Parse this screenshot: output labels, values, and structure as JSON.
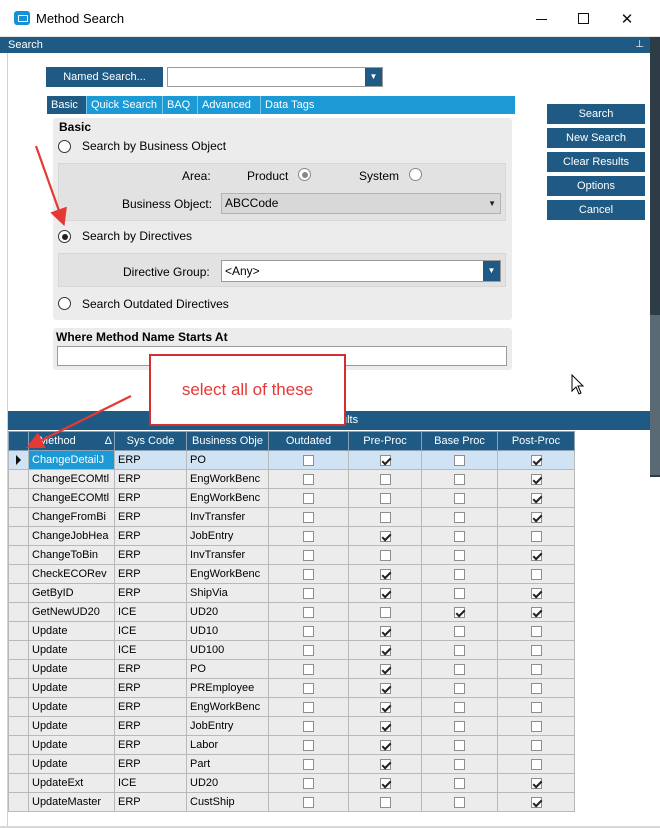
{
  "window": {
    "title": "Method Search",
    "icon": "method-search-app-icon"
  },
  "search_header": {
    "label": "Search"
  },
  "named_search": {
    "button_label": "Named Search...",
    "value": ""
  },
  "tabs": [
    {
      "label": "Basic",
      "active": true
    },
    {
      "label": "Quick Search",
      "active": false
    },
    {
      "label": "BAQ",
      "active": false
    },
    {
      "label": "Advanced",
      "active": false
    },
    {
      "label": "Data Tags",
      "active": false
    }
  ],
  "basic": {
    "title": "Basic",
    "by_business_object": {
      "label": "Search by Business Object",
      "selected": false
    },
    "area_label": "Area:",
    "area_product": {
      "label": "Product",
      "selected": true
    },
    "area_system": {
      "label": "System",
      "selected": false
    },
    "business_object_label": "Business Object:",
    "business_object_value": "ABCCode",
    "by_directives": {
      "label": "Search by Directives",
      "selected": true
    },
    "directive_group_label": "Directive Group:",
    "directive_group_value": "<Any>",
    "outdated": {
      "label": "Search Outdated Directives",
      "selected": false
    }
  },
  "where": {
    "title": "Where Method Name Starts At",
    "value": ""
  },
  "actions": [
    {
      "label": "Search"
    },
    {
      "label": "New Search"
    },
    {
      "label": "Clear Results"
    },
    {
      "label": "Options"
    },
    {
      "label": "Cancel"
    }
  ],
  "annotation": {
    "callout_text": "select all of these",
    "color": "#e53935"
  },
  "results": {
    "header_label": "ults",
    "columns": [
      "Method",
      "Sys Code",
      "Business Obje",
      "Outdated",
      "Pre-Proc",
      "Base Proc",
      "Post-Proc"
    ],
    "sort_indicator": "Δ",
    "rows": [
      {
        "method": "ChangeDetailJ",
        "sys": "ERP",
        "bo": "PO",
        "outdated": false,
        "pre": true,
        "base": false,
        "post": true,
        "selected": true
      },
      {
        "method": "ChangeECOMtl",
        "sys": "ERP",
        "bo": "EngWorkBenc",
        "outdated": false,
        "pre": false,
        "base": false,
        "post": true
      },
      {
        "method": "ChangeECOMtl",
        "sys": "ERP",
        "bo": "EngWorkBenc",
        "outdated": false,
        "pre": false,
        "base": false,
        "post": true
      },
      {
        "method": "ChangeFromBi",
        "sys": "ERP",
        "bo": "InvTransfer",
        "outdated": false,
        "pre": false,
        "base": false,
        "post": true
      },
      {
        "method": "ChangeJobHea",
        "sys": "ERP",
        "bo": "JobEntry",
        "outdated": false,
        "pre": true,
        "base": false,
        "post": false
      },
      {
        "method": "ChangeToBin",
        "sys": "ERP",
        "bo": "InvTransfer",
        "outdated": false,
        "pre": false,
        "base": false,
        "post": true
      },
      {
        "method": "CheckECORev",
        "sys": "ERP",
        "bo": "EngWorkBenc",
        "outdated": false,
        "pre": true,
        "base": false,
        "post": false
      },
      {
        "method": "GetByID",
        "sys": "ERP",
        "bo": "ShipVia",
        "outdated": false,
        "pre": true,
        "base": false,
        "post": true
      },
      {
        "method": "GetNewUD20",
        "sys": "ICE",
        "bo": "UD20",
        "outdated": false,
        "pre": false,
        "base": true,
        "post": true
      },
      {
        "method": "Update",
        "sys": "ICE",
        "bo": "UD10",
        "outdated": false,
        "pre": true,
        "base": false,
        "post": false
      },
      {
        "method": "Update",
        "sys": "ICE",
        "bo": "UD100",
        "outdated": false,
        "pre": true,
        "base": false,
        "post": false
      },
      {
        "method": "Update",
        "sys": "ERP",
        "bo": "PO",
        "outdated": false,
        "pre": true,
        "base": false,
        "post": false
      },
      {
        "method": "Update",
        "sys": "ERP",
        "bo": "PREmployee",
        "outdated": false,
        "pre": true,
        "base": false,
        "post": false
      },
      {
        "method": "Update",
        "sys": "ERP",
        "bo": "EngWorkBenc",
        "outdated": false,
        "pre": true,
        "base": false,
        "post": false
      },
      {
        "method": "Update",
        "sys": "ERP",
        "bo": "JobEntry",
        "outdated": false,
        "pre": true,
        "base": false,
        "post": false
      },
      {
        "method": "Update",
        "sys": "ERP",
        "bo": "Labor",
        "outdated": false,
        "pre": true,
        "base": false,
        "post": false
      },
      {
        "method": "Update",
        "sys": "ERP",
        "bo": "Part",
        "outdated": false,
        "pre": true,
        "base": false,
        "post": false
      },
      {
        "method": "UpdateExt",
        "sys": "ICE",
        "bo": "UD20",
        "outdated": false,
        "pre": true,
        "base": false,
        "post": true
      },
      {
        "method": "UpdateMaster",
        "sys": "ERP",
        "bo": "CustShip",
        "outdated": false,
        "pre": false,
        "base": false,
        "post": true
      }
    ]
  }
}
